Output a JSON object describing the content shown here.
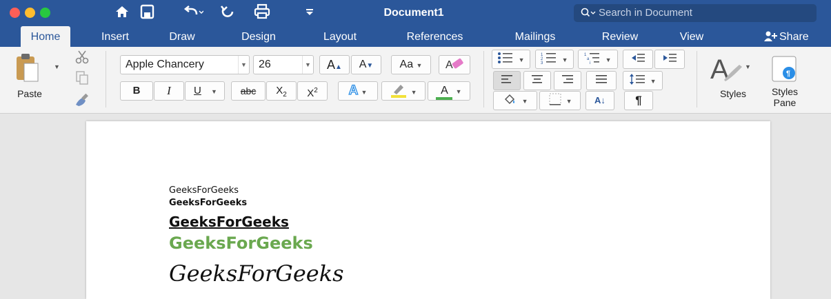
{
  "window": {
    "title": "Document1",
    "search_placeholder": "Search in Document"
  },
  "tabs": [
    "Home",
    "Insert",
    "Draw",
    "Design",
    "Layout",
    "References",
    "Mailings",
    "Review",
    "View"
  ],
  "share_label": "Share",
  "ribbon": {
    "clipboard": {
      "paste_label": "Paste"
    },
    "font": {
      "family": "Apple Chancery",
      "size": "26",
      "grow_label": "A",
      "shrink_label": "A",
      "case_label": "Aa",
      "bold_label": "B",
      "italic_label": "I",
      "underline_label": "U",
      "strike_label": "abc",
      "subscript_label": "X",
      "superscript_label": "X",
      "sub_digit": "2",
      "sup_digit": "2",
      "effects_label": "A",
      "fontcolor_label": "A",
      "highlight_color": "#f2e13a",
      "font_color": "#4caf50"
    },
    "paragraph": {
      "pilcrow": "¶",
      "sort_label": "A↓"
    },
    "styles": {
      "styles_label": "Styles",
      "pane_label": "Styles\nPane",
      "pane_line1": "Styles",
      "pane_line2": "Pane"
    }
  },
  "document": {
    "lines": [
      "GeeksForGeeks",
      "GeeksForGeeks",
      "GeeksForGeeks",
      "GeeksForGeeks",
      "GeeksForGeeks"
    ],
    "green_color": "#6aa84f"
  },
  "colors": {
    "accent": "#2b579a",
    "close": "#fe5f57",
    "minimize": "#febc2e",
    "zoom": "#28c840"
  }
}
